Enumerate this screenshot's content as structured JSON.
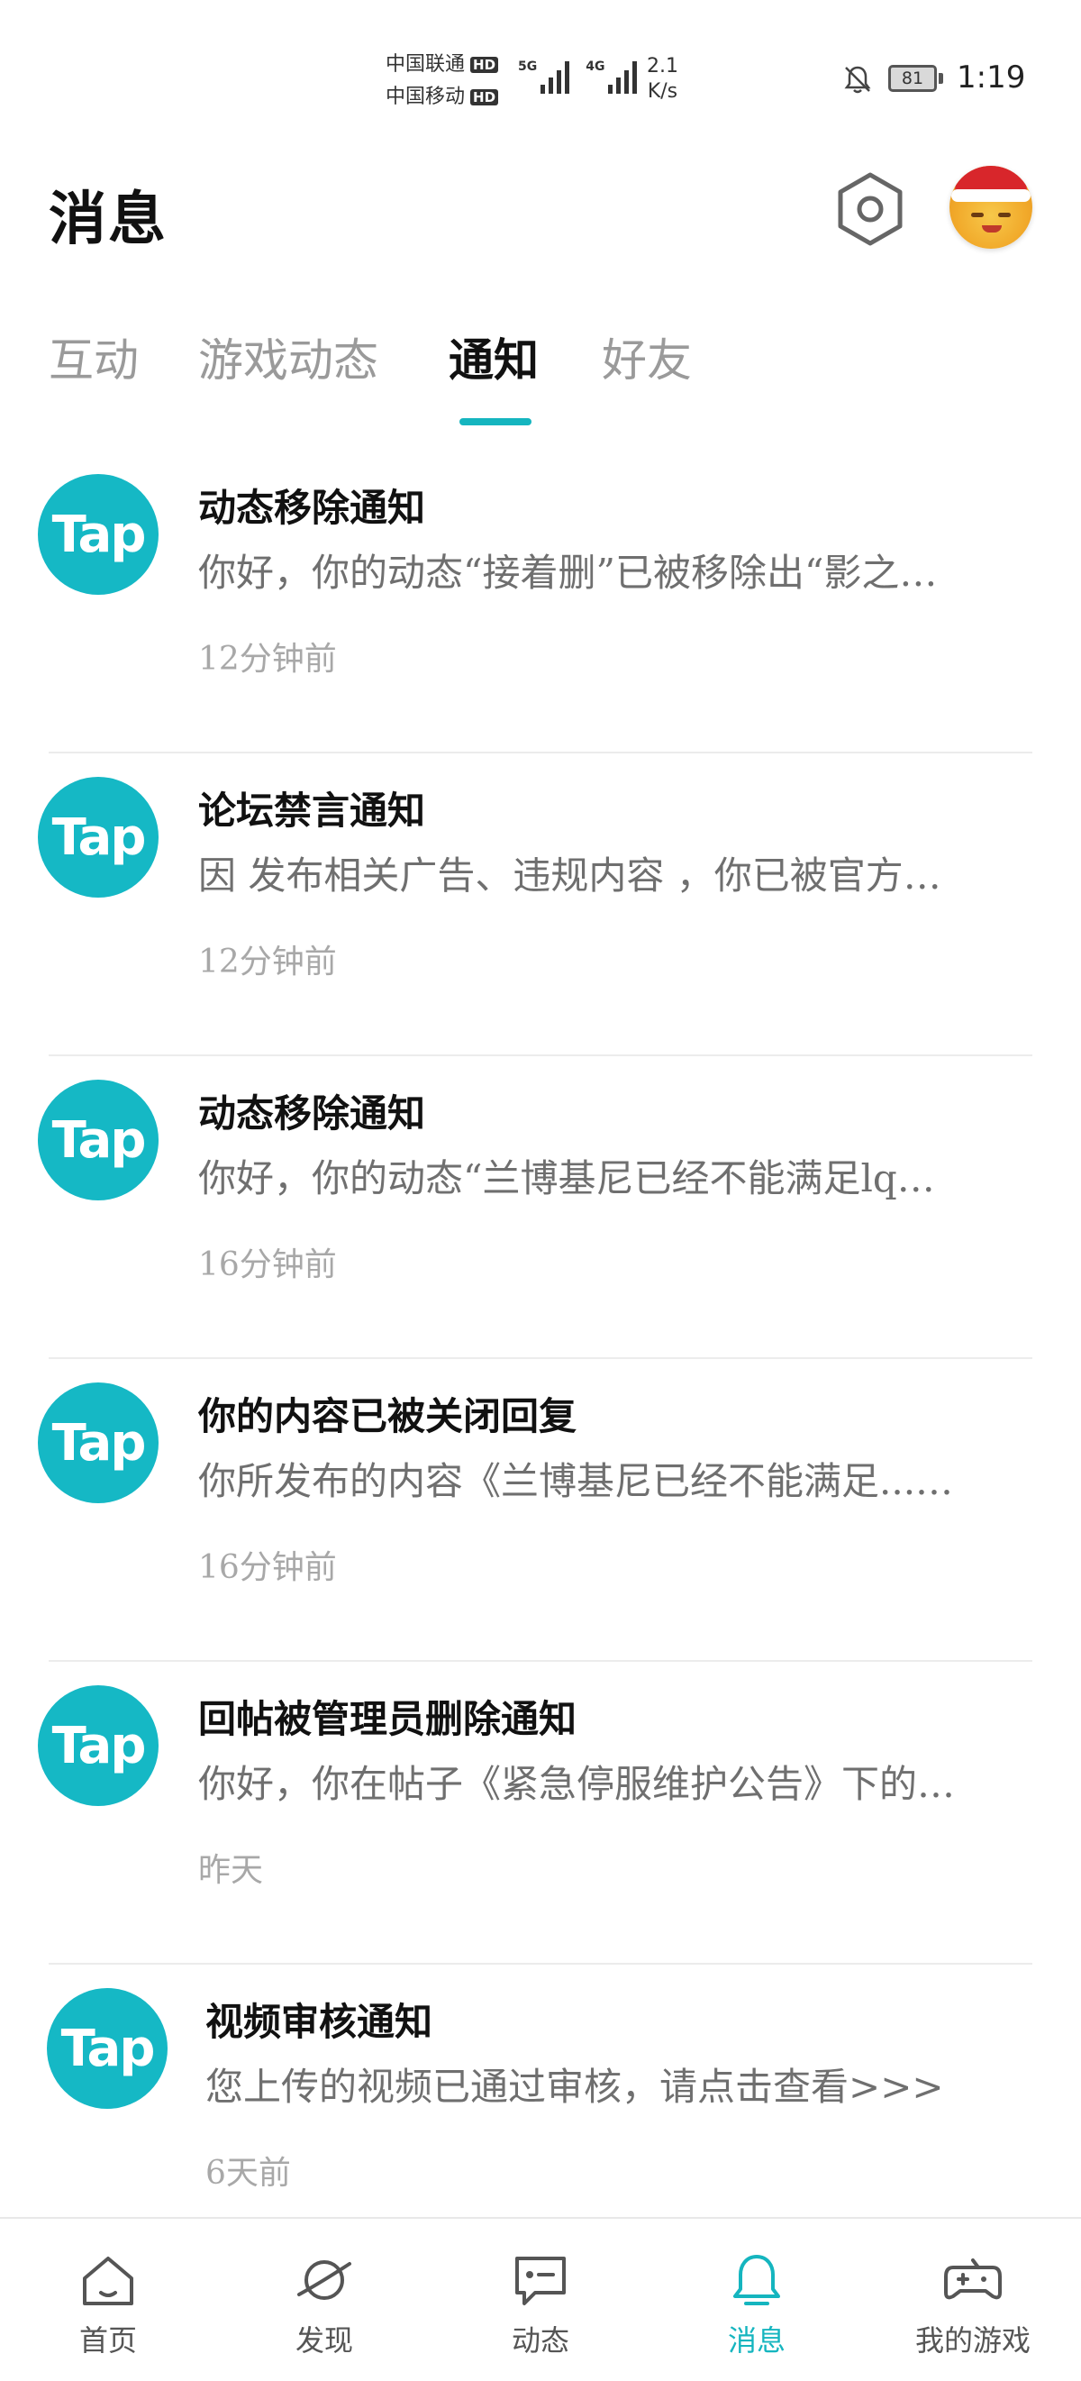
{
  "status_bar": {
    "carrier1": "中国联通",
    "carrier2": "中国移动",
    "hd": "HD",
    "net1": "5G",
    "net2": "4G",
    "speed_value": "2.1",
    "speed_unit": "K/s",
    "battery": "81",
    "time": "1:19"
  },
  "header": {
    "title": "消息",
    "settings_icon": "hexagon-settings-icon",
    "avatar_icon": "santa-emoji-avatar"
  },
  "tabs": [
    {
      "label": "互动",
      "active": false
    },
    {
      "label": "游戏动态",
      "active": false
    },
    {
      "label": "通知",
      "active": true
    },
    {
      "label": "好友",
      "active": false
    }
  ],
  "accent_color": "#15b5bf",
  "logo_text": "Tap",
  "notifications": [
    {
      "title": "动态移除通知",
      "body": "你好，你的动态“接着删”已被移除出“影之…",
      "time": "12分钟前"
    },
    {
      "title": "论坛禁言通知",
      "body": "因 发布相关广告、违规内容 ，你已被官方…",
      "time": "12分钟前"
    },
    {
      "title": "动态移除通知",
      "body": "你好，你的动态“兰博基尼已经不能满足lq…",
      "time": "16分钟前"
    },
    {
      "title": "你的内容已被关闭回复",
      "body": "你所发布的内容《兰博基尼已经不能满足...…",
      "time": "16分钟前"
    },
    {
      "title": "回帖被管理员删除通知",
      "body": "你好，你在帖子《紧急停服维护公告》下的…",
      "time": "昨天"
    },
    {
      "title": "视频审核通知",
      "body": "您上传的视频已通过审核，请点击查看>>>",
      "time": "6天前"
    }
  ],
  "bottom_nav": [
    {
      "label": "首页",
      "icon": "home-icon",
      "active": false
    },
    {
      "label": "发现",
      "icon": "planet-icon",
      "active": false
    },
    {
      "label": "动态",
      "icon": "chat-icon",
      "active": false
    },
    {
      "label": "消息",
      "icon": "bell-icon",
      "active": true
    },
    {
      "label": "我的游戏",
      "icon": "gamepad-icon",
      "active": false
    }
  ]
}
